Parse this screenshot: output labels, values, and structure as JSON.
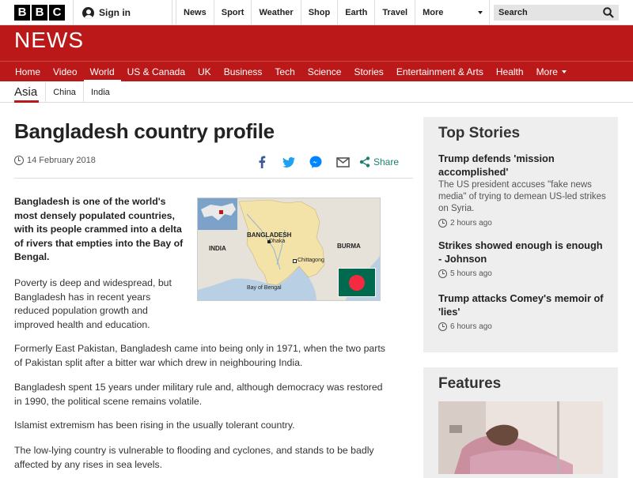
{
  "topbar": {
    "logo_letters": [
      "B",
      "B",
      "C"
    ],
    "signin_label": "Sign in",
    "nav": [
      "News",
      "Sport",
      "Weather",
      "Shop",
      "Earth",
      "Travel"
    ],
    "more_label": "More",
    "search_placeholder": "Search"
  },
  "header": {
    "section_logo": "NEWS",
    "brand_color": "#bb1919",
    "nav": [
      "Home",
      "Video",
      "World",
      "US & Canada",
      "UK",
      "Business",
      "Tech",
      "Science",
      "Stories",
      "Entertainment & Arts",
      "Health"
    ],
    "active_nav": "World",
    "more_label": "More"
  },
  "subnav": {
    "items": [
      "Asia",
      "China",
      "India"
    ]
  },
  "article": {
    "title": "Bangladesh country profile",
    "date": "14 February 2018",
    "share_label": "Share",
    "share_icons": [
      "facebook-icon",
      "twitter-icon",
      "messenger-icon",
      "email-icon",
      "share-icon"
    ],
    "lead": "Bangladesh is one of the world's most densely populated countries, with its people crammed into a delta of rivers that empties into the Bay of Bengal.",
    "para1": "Poverty is deep and widespread, but Bangladesh has in recent years reduced population growth and improved health and education.",
    "para2": "Formerly East Pakistan, Bangladesh came into being only in 1971, when the two parts of Pakistan split after a bitter war which drew in neighbouring India.",
    "para3": "Bangladesh spent 15 years under military rule and, although democracy was restored in 1990, the political scene remains volatile.",
    "para4": "Islamist extremism has been rising in the usually tolerant country.",
    "para5": "The low-lying country is vulnerable to flooding and cyclones, and stands to be badly affected by any rises in sea levels."
  },
  "map": {
    "labels": {
      "country": "BANGLADESH",
      "india": "INDIA",
      "burma": "BURMA",
      "capital": "Dhaka",
      "city": "Chittagong",
      "sea": "Bay of Bengal"
    }
  },
  "sidebar": {
    "top_stories_title": "Top Stories",
    "stories": [
      {
        "headline": "Trump defends 'mission accomplished'",
        "summary": "The US president accuses \"fake news media\" of trying to demean US-led strikes on Syria.",
        "time": "2 hours ago"
      },
      {
        "headline": "Strikes showed enough is enough - Johnson",
        "summary": "",
        "time": "5 hours ago"
      },
      {
        "headline": "Trump attacks Comey's memoir of 'lies'",
        "summary": "",
        "time": "6 hours ago"
      }
    ],
    "features_title": "Features"
  }
}
